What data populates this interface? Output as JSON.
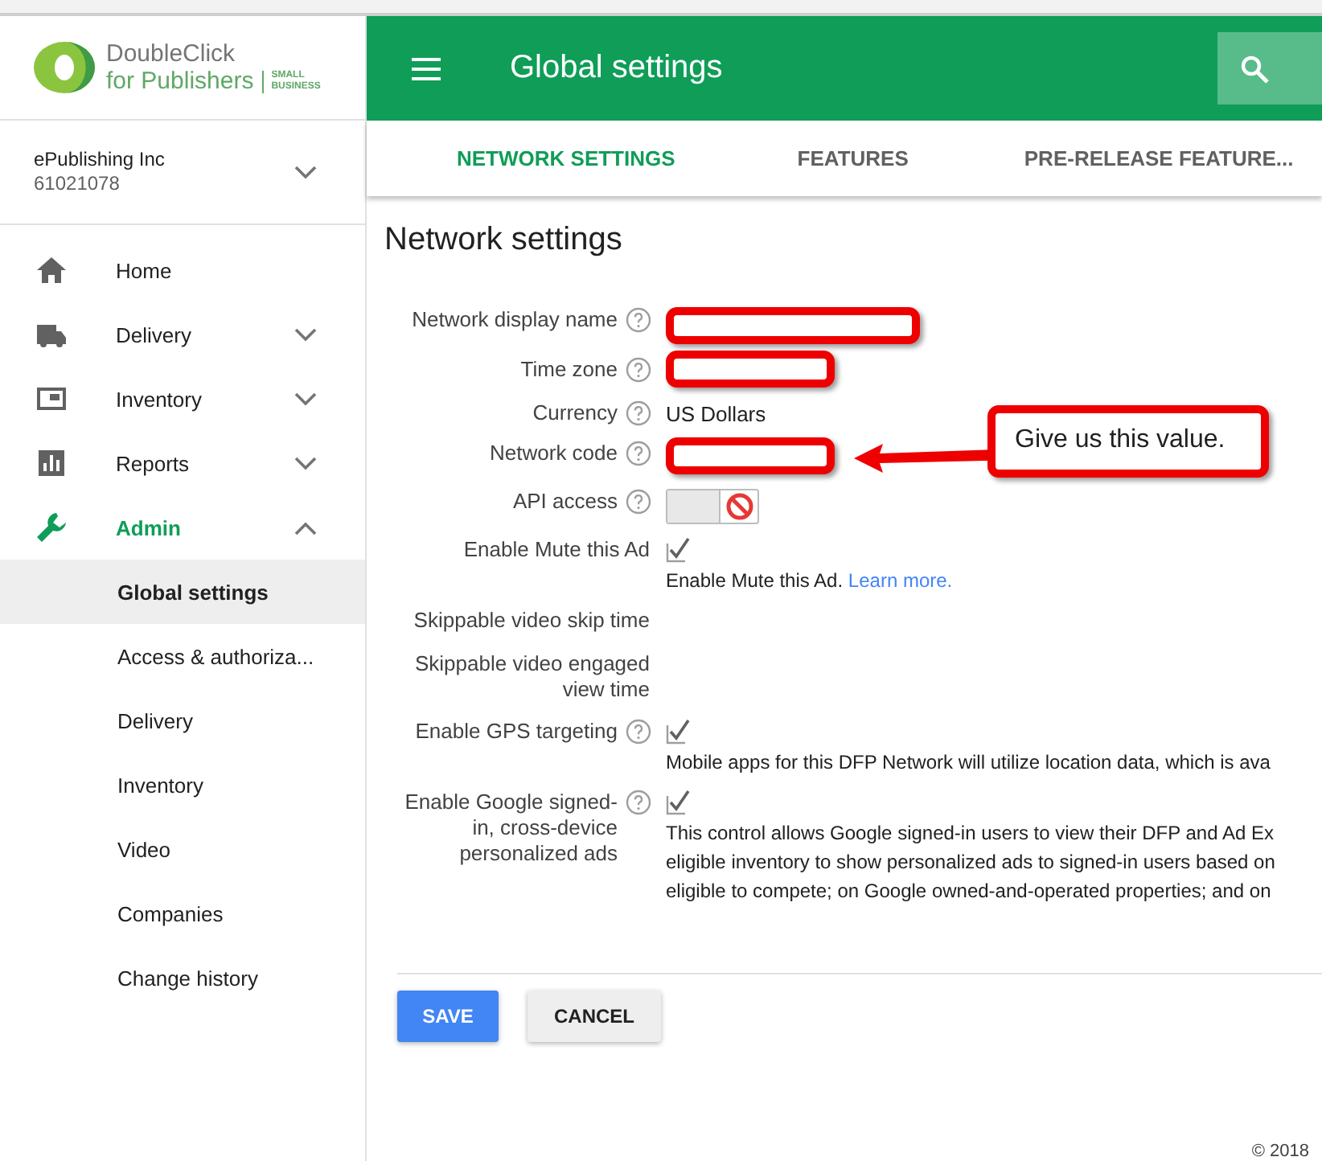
{
  "logo": {
    "line1": "DoubleClick",
    "line2": "for Publishers",
    "tier_line1": "SMALL",
    "tier_line2": "BUSINESS"
  },
  "header": {
    "title": "Global settings"
  },
  "account": {
    "name": "ePublishing Inc",
    "id": "61021078"
  },
  "nav": [
    {
      "label": "Home",
      "selected": false
    },
    {
      "label": "Delivery",
      "selected": false,
      "expanded": false
    },
    {
      "label": "Inventory",
      "selected": false,
      "expanded": false
    },
    {
      "label": "Reports",
      "selected": false,
      "expanded": false
    },
    {
      "label": "Admin",
      "selected": true,
      "expanded": true,
      "children": [
        {
          "label": "Global settings",
          "selected": true
        },
        {
          "label": "Access & authoriza...",
          "selected": false
        },
        {
          "label": "Delivery",
          "selected": false
        },
        {
          "label": "Inventory",
          "selected": false
        },
        {
          "label": "Video",
          "selected": false
        },
        {
          "label": "Companies",
          "selected": false
        },
        {
          "label": "Change history",
          "selected": false
        }
      ]
    }
  ],
  "tabs": [
    {
      "label": "NETWORK SETTINGS",
      "selected": true
    },
    {
      "label": "FEATURES",
      "selected": false
    },
    {
      "label": "PRE-RELEASE FEATURE...",
      "selected": false
    }
  ],
  "page_title": "Network settings",
  "fields": [
    {
      "kind": "redacted",
      "label": "Network display name",
      "help": true,
      "wide": true
    },
    {
      "kind": "redacted",
      "label": "Time zone",
      "help": true,
      "wide": false
    },
    {
      "kind": "text",
      "label": "Currency",
      "help": true,
      "value": "US Dollars"
    },
    {
      "kind": "redacted",
      "label": "Network code",
      "help": true,
      "wide": false,
      "callout": "Give us this value."
    },
    {
      "kind": "toggle",
      "label": "API access",
      "help": true,
      "on": false
    },
    {
      "kind": "checkbox",
      "label": "Enable Mute this Ad",
      "help": false,
      "checked": true,
      "description": [
        "Enable Mute this Ad."
      ],
      "link": "Learn more."
    },
    {
      "kind": "empty",
      "label": "Skippable video skip time",
      "help": false
    },
    {
      "kind": "empty",
      "label": "Skippable video engaged view time",
      "help": false
    },
    {
      "kind": "checkbox",
      "label": "Enable GPS targeting",
      "help": true,
      "checked": true,
      "description": [
        "Mobile apps for this DFP Network will utilize location data, which is ava"
      ]
    },
    {
      "kind": "checkbox",
      "label": "Enable Google signed-in, cross-device personalized ads",
      "help": true,
      "checked": true,
      "description": [
        "This control allows Google signed-in users to view their DFP and Ad Ex",
        "eligible inventory to show personalized ads to signed-in users based on",
        "eligible to compete; on Google owned-and-operated properties; and on"
      ]
    }
  ],
  "buttons": [
    {
      "kind": "primary",
      "label": "SAVE"
    },
    {
      "kind": "secondary",
      "label": "CANCEL"
    }
  ],
  "footer": "© 2018"
}
